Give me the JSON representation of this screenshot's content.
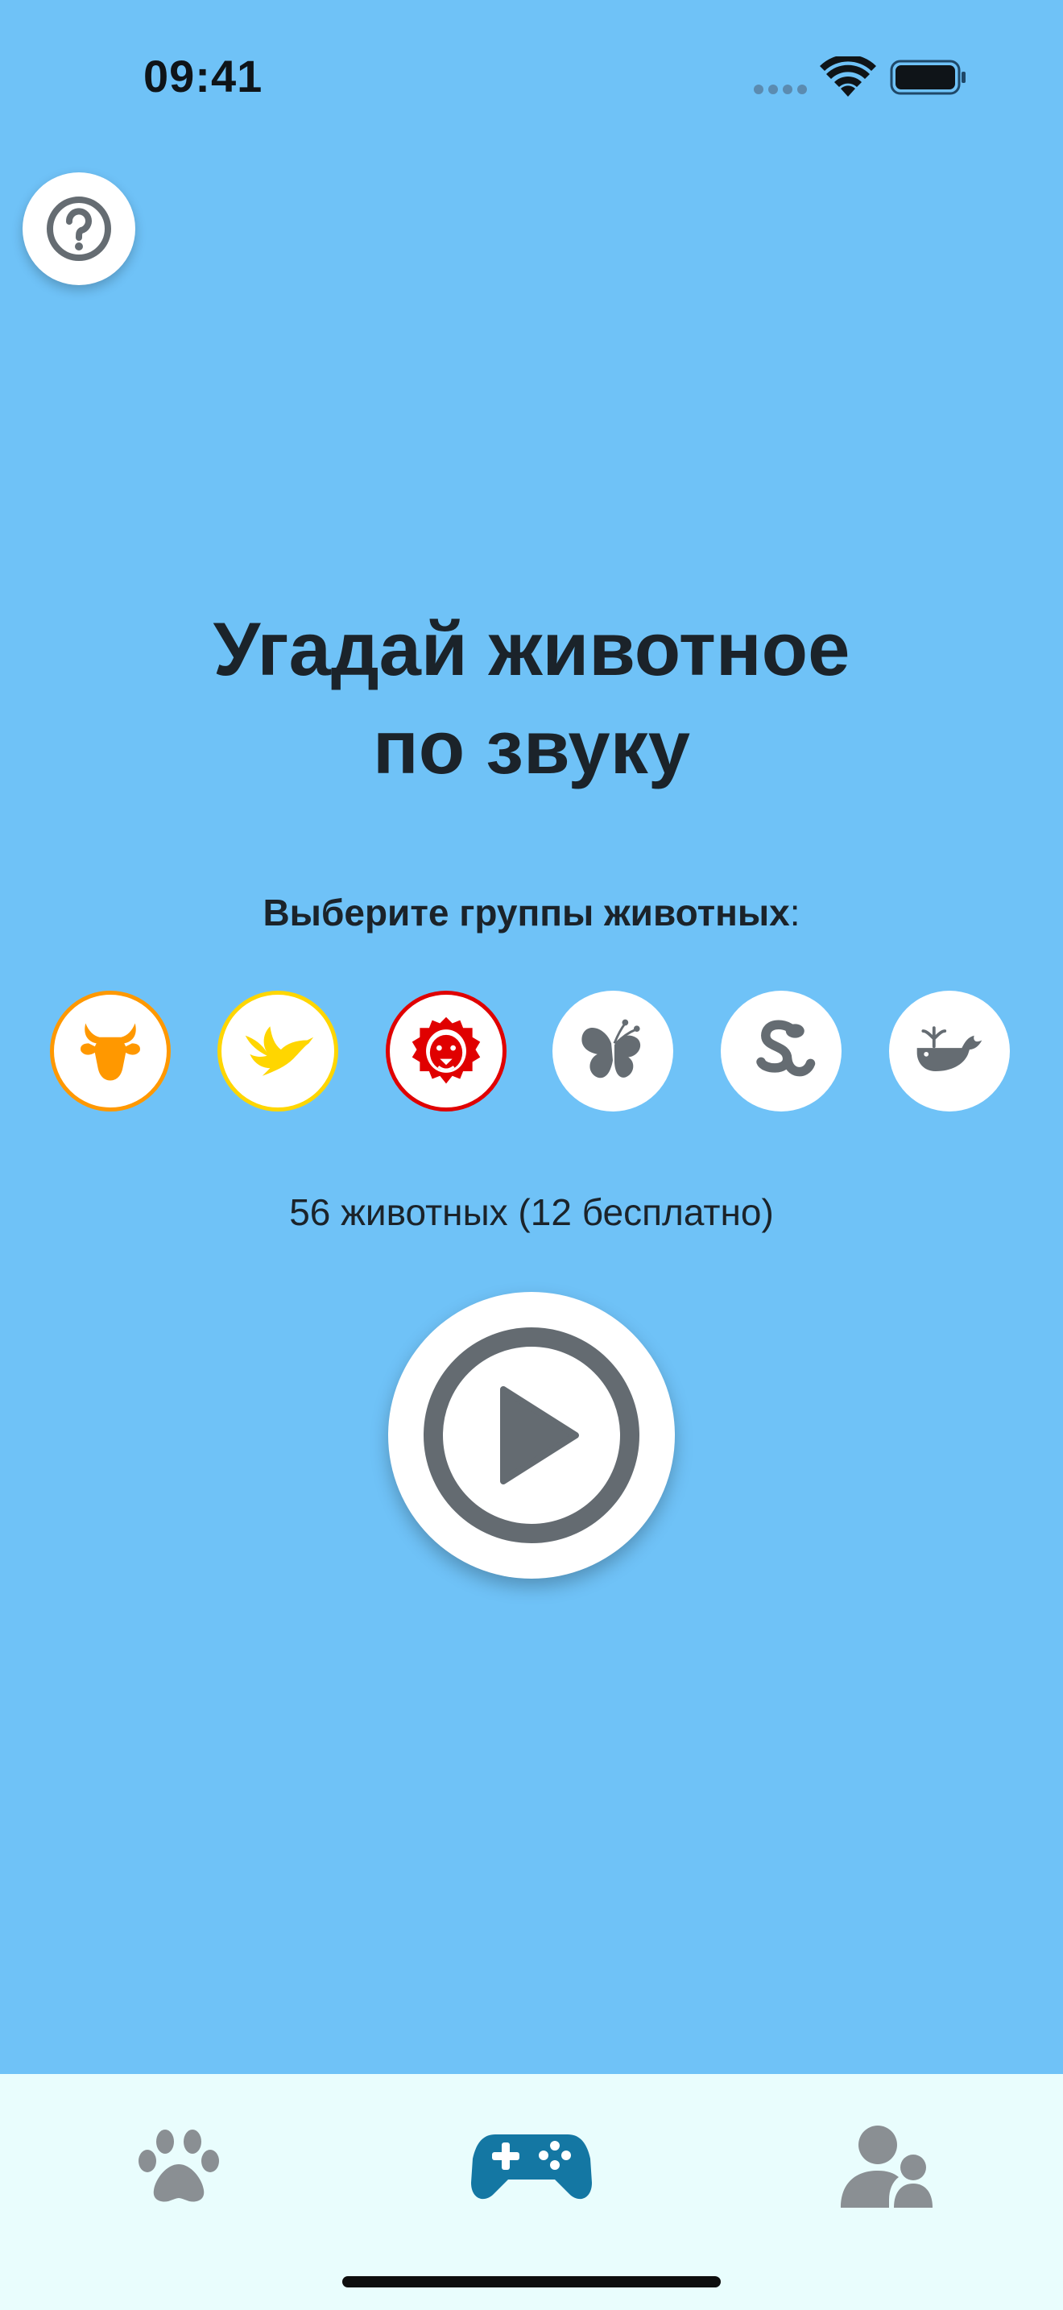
{
  "status_bar": {
    "time": "09:41"
  },
  "header": {
    "title_line1": "Угадай животное",
    "title_line2": "по звуку"
  },
  "groups": {
    "label": "Выберите группы животных",
    "label_suffix": ":",
    "items": [
      {
        "name": "farm",
        "icon": "cow-icon",
        "color": "#ff9800",
        "selected": true
      },
      {
        "name": "birds",
        "icon": "bird-icon",
        "color": "#ffd600",
        "selected": true
      },
      {
        "name": "wild",
        "icon": "lion-icon",
        "color": "#e00000",
        "selected": true
      },
      {
        "name": "insects",
        "icon": "butterfly-icon",
        "color": "#656c72",
        "selected": false
      },
      {
        "name": "reptiles",
        "icon": "snake-icon",
        "color": "#656c72",
        "selected": false
      },
      {
        "name": "sea",
        "icon": "whale-icon",
        "color": "#656c72",
        "selected": false
      }
    ]
  },
  "count_text": "56 животных (12 бесплатно)",
  "play": {
    "icon": "play-icon",
    "color": "#646b71"
  },
  "help": {
    "icon": "question-icon"
  },
  "tab_bar": {
    "tabs": [
      {
        "icon": "paw-icon",
        "active": false,
        "color": "#8a8f93"
      },
      {
        "icon": "gamepad-icon",
        "active": true,
        "color": "#1477a3"
      },
      {
        "icon": "users-icon",
        "active": false,
        "color": "#8a8f93"
      }
    ]
  },
  "colors": {
    "background": "#6fc2f7",
    "tab_bar": "#e9fdfd"
  }
}
